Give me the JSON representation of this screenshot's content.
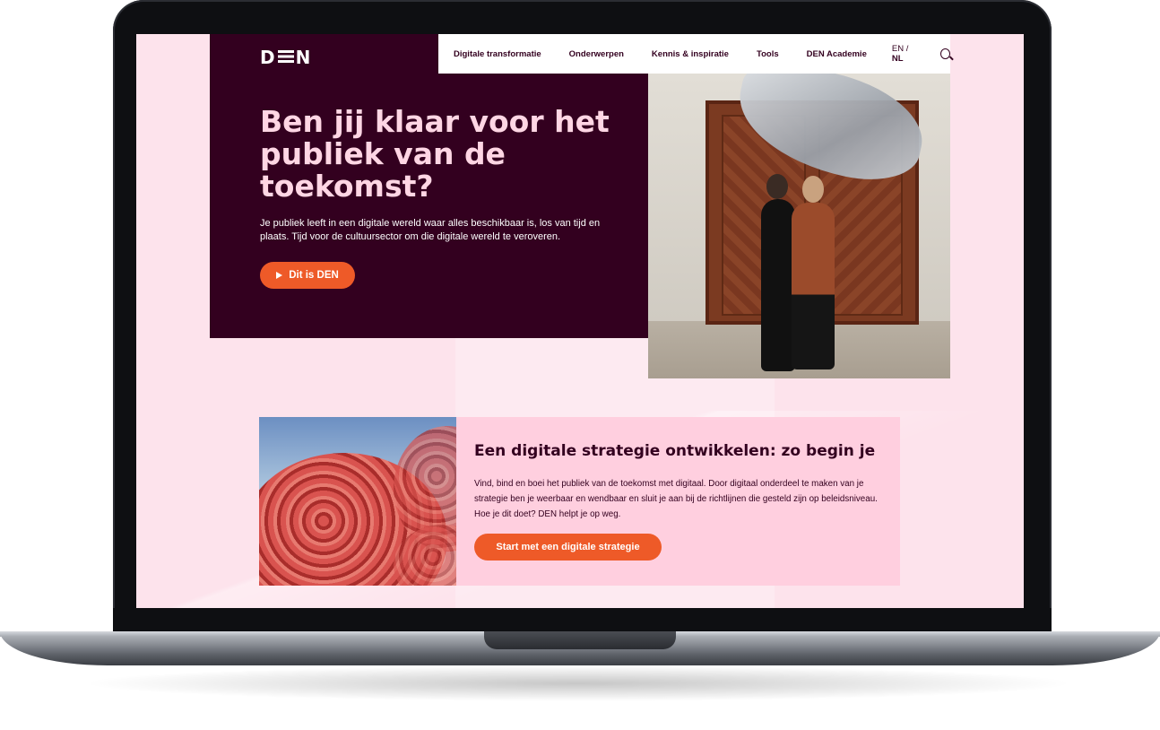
{
  "site": {
    "logo": "DEN"
  },
  "nav": {
    "items": [
      "Digitale transformatie",
      "Onderwerpen",
      "Kennis & inspiratie",
      "Tools",
      "DEN Academie"
    ],
    "lang_en": "EN",
    "lang_sep": " / ",
    "lang_nl": "NL"
  },
  "hero": {
    "title": "Ben jij klaar voor het publiek van de toekomst?",
    "text": "Je publiek leeft in een digitale wereld waar alles beschikbaar is, los van tijd en plaats. Tijd voor de cultuursector om die digitale wereld te veroveren.",
    "button": "Dit is DEN"
  },
  "feature": {
    "title": "Een digitale strategie ontwikkelen: zo begin je",
    "text": "Vind, bind en boei het publiek van de toekomst met digitaal. Door digitaal onderdeel te maken van je strategie ben je weerbaar en wendbaar en sluit je aan bij de richtlijnen die gesteld zijn op beleidsniveau. Hoe je dit doet? DEN helpt je op weg.",
    "button": "Start met een digitale strategie"
  },
  "colors": {
    "dark": "#33001f",
    "accent": "#ee5a28",
    "pink": "#fde3ec",
    "card": "#ffcfdf"
  }
}
